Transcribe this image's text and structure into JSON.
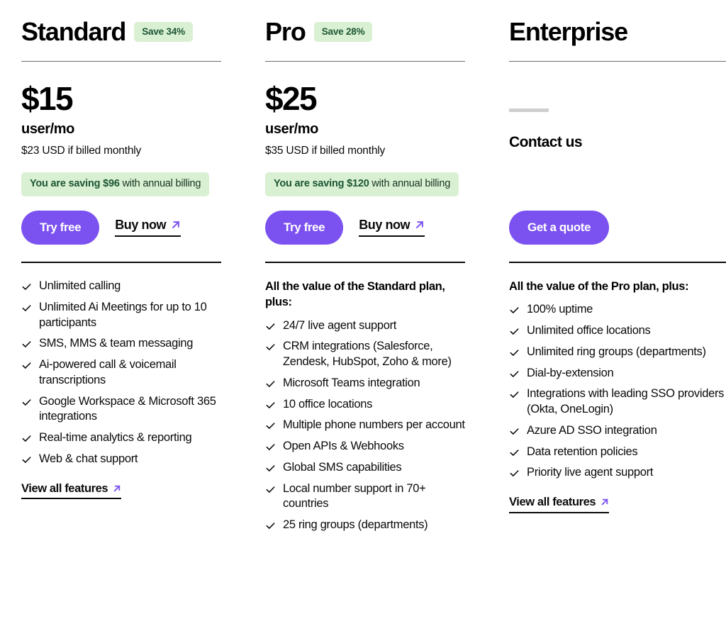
{
  "theme": {
    "accent_purple": "#7B52F0",
    "badge_green_bg": "#D9F0D3",
    "badge_green_text": "#1D5632",
    "text_black": "#0A0A0A",
    "rule_gray": "#6B6B6B",
    "placeholder_gray": "#CFCFCF"
  },
  "icons": {
    "check": "check-icon",
    "arrow_up_right": "arrow-up-right-icon"
  },
  "plans": [
    {
      "id": "standard",
      "name": "Standard",
      "save_badge": "Save 34%",
      "price_amount": "$15",
      "price_unit": "user/mo",
      "price_note": "$23 USD if billed monthly",
      "saving_prefix": "You are saving $96",
      "saving_suffix": " with annual billing",
      "primary_cta": "Try free",
      "secondary_cta": "Buy now",
      "features_intro": "",
      "features": [
        "Unlimited calling",
        "Unlimited Ai Meetings for up to 10 participants",
        "SMS, MMS & team messaging",
        "Ai-powered call & voicemail transcriptions",
        "Google Workspace & Microsoft 365 integrations",
        "Real-time analytics & reporting",
        "Web & chat support"
      ],
      "view_all": "View all features"
    },
    {
      "id": "pro",
      "name": "Pro",
      "save_badge": "Save 28%",
      "price_amount": "$25",
      "price_unit": "user/mo",
      "price_note": "$35 USD if billed monthly",
      "saving_prefix": "You are saving $120",
      "saving_suffix": " with annual billing",
      "primary_cta": "Try free",
      "secondary_cta": "Buy now",
      "features_intro": "All the value of the Standard plan, plus:",
      "features": [
        "24/7 live agent support",
        "CRM integrations (Salesforce, Zendesk, HubSpot, Zoho & more)",
        "Microsoft Teams integration",
        "10 office locations",
        "Multiple phone numbers per account",
        "Open APIs & Webhooks",
        "Global SMS capabilities",
        "Local number support in 70+ countries",
        "25 ring groups (departments)"
      ],
      "view_all": ""
    },
    {
      "id": "enterprise",
      "name": "Enterprise",
      "save_badge": "",
      "price_amount": "",
      "price_unit": "",
      "price_note": "",
      "contact_heading": "Contact us",
      "primary_cta": "Get a quote",
      "secondary_cta": "",
      "features_intro": "All the value of the Pro plan, plus:",
      "features": [
        "100% uptime",
        "Unlimited office locations",
        "Unlimited ring groups (departments)",
        "Dial-by-extension",
        "Integrations with leading SSO providers (Okta, OneLogin)",
        "Azure AD SSO integration",
        "Data retention policies",
        "Priority live agent support"
      ],
      "view_all": "View all features"
    }
  ]
}
